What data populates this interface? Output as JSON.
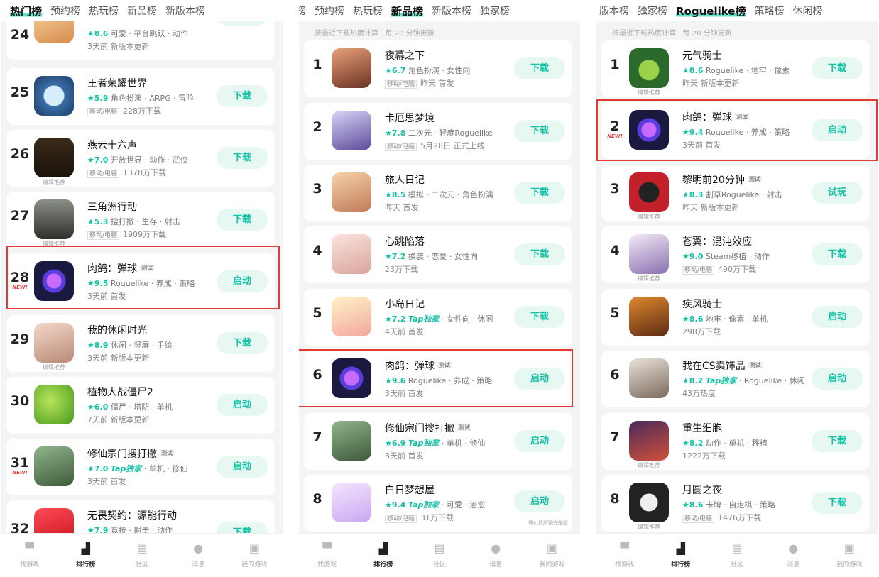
{
  "panels": [
    {
      "tabs": [
        "热门榜",
        "预约榜",
        "热玩榜",
        "新品榜",
        "新版本榜"
      ],
      "note": "",
      "items": [
        {
          "rank": "24",
          "title": "",
          "meta_rating": "★8.6",
          "meta_tags": "可爱 · 平台跳跃 · 动作",
          "sub": "3天前 新版本更新",
          "button": "试玩"
        },
        {
          "rank": "25",
          "title": "王者荣耀世界",
          "meta_rating": "★5.9",
          "meta_tags": "角色扮演 · ARPG · 冒险",
          "platform": "移动/电脑",
          "sub": "228万下载",
          "button": "下载"
        },
        {
          "rank": "26",
          "title": "燕云十六声",
          "meta_rating": "★7.0",
          "meta_tags": "开放世界 · 动作 · 武侠",
          "platform": "移动/电脑",
          "sub": "1378万下载",
          "button": "下载",
          "editor": "编辑推荐"
        },
        {
          "rank": "27",
          "title": "三角洲行动",
          "meta_rating": "★5.3",
          "meta_tags": "搜打撤 · 生存 · 射击",
          "platform": "移动/电脑",
          "sub": "1909万下载",
          "button": "下载",
          "editor": "编辑推荐"
        },
        {
          "rank": "28",
          "new": "NEW!",
          "title": "肉鸽：弹球",
          "test": "测试",
          "meta_rating": "★9.5",
          "meta_tags": "Roguelike · 养成 · 策略",
          "sub": "3天前 首发",
          "button": "启动"
        },
        {
          "rank": "29",
          "title": "我的休闲时光",
          "meta_rating": "★8.9",
          "meta_tags": "休闲 · 竖屏 · 手绘",
          "sub": "3天前 新版本更新",
          "button": "下载",
          "editor": "编辑推荐"
        },
        {
          "rank": "30",
          "title": "植物大战僵尸2",
          "meta_rating": "★6.0",
          "meta_tags": "僵尸 · 塔防 · 单机",
          "sub": "7天前 新版本更新",
          "button": "启动"
        },
        {
          "rank": "31",
          "new": "NEW!",
          "title": "修仙宗门搜打撤",
          "test": "测试",
          "meta_rating": "★7.0",
          "exclusive": "Tap独家",
          "meta_tags": " · 单机 · 修仙",
          "sub": "3天前 首发",
          "button": "启动"
        },
        {
          "rank": "32",
          "title": "无畏契约：源能行动",
          "meta_rating": "★7.9",
          "meta_tags": "竞技 · 射击 · 动作",
          "sub": "",
          "button": "下载"
        }
      ]
    },
    {
      "tabs": [
        "约榜",
        "预约榜",
        "热玩榜",
        "新品榜",
        "新版本榜",
        "独家榜"
      ],
      "note": "按最近下载热度计算 · 每 20 分钟更新",
      "items": [
        {
          "rank": "1",
          "title": "夜幕之下",
          "meta_rating": "★6.7",
          "meta_tags": "角色扮演 · 女性向",
          "platform": "移动/电脑",
          "sub": "昨天 首发",
          "button": "下载"
        },
        {
          "rank": "2",
          "title": "卡厄思梦境",
          "meta_rating": "★7.8",
          "meta_tags": "二次元 · 轻度Roguelike",
          "platform": "移动/电脑",
          "sub": "5月28日 正式上线",
          "button": "下载"
        },
        {
          "rank": "3",
          "title": "旅人日记",
          "meta_rating": "★8.5",
          "meta_tags": "模拟 · 二次元 · 角色扮演",
          "sub": "昨天 首发",
          "button": "下载"
        },
        {
          "rank": "4",
          "title": "心跳陷落",
          "meta_rating": "★7.2",
          "meta_tags": "换装 · 恋爱 · 女性向",
          "sub": "23万下载",
          "button": "下载"
        },
        {
          "rank": "5",
          "title": "小岛日记",
          "meta_rating": "★7.2",
          "exclusive": "Tap独家",
          "meta_tags": " · 女性向 · 休闲",
          "sub": "4天前 首发",
          "button": "下载"
        },
        {
          "rank": "6",
          "title": "肉鸽：弹球",
          "test": "测试",
          "meta_rating": "★9.6",
          "meta_tags": "Roguelike · 养成 · 策略",
          "sub": "3天前 首发",
          "button": "启动"
        },
        {
          "rank": "7",
          "title": "修仙宗门搜打撤",
          "test": "测试",
          "meta_rating": "★6.9",
          "exclusive": "Tap独家",
          "meta_tags": " · 单机 · 修仙",
          "sub": "3天前 首发",
          "button": "启动"
        },
        {
          "rank": "8",
          "title": "白日梦想屋",
          "meta_rating": "★9.4",
          "exclusive": "Tap独家",
          "meta_tags": " · 可爱 · 治愈",
          "platform": "移动/电脑",
          "sub": "31万下载",
          "button": "启动",
          "button_note": "需付费解锁完整版"
        }
      ]
    },
    {
      "tabs": [
        "版本榜",
        "独家榜",
        "Roguelike榜",
        "策略榜",
        "休闲榜"
      ],
      "note": "按最近下载热度计算 · 每 20 分钟更新",
      "items": [
        {
          "rank": "1",
          "title": "元气骑士",
          "meta_rating": "★8.6",
          "meta_tags": "Roguelike · 地牢 · 像素",
          "sub": "昨天 新版本更新",
          "button": "下载",
          "editor": "编辑推荐"
        },
        {
          "rank": "2",
          "new": "NEW!",
          "title": "肉鸽：弹球",
          "test": "测试",
          "meta_rating": "★9.4",
          "meta_tags": "Roguelike · 养成 · 策略",
          "sub": "3天前 首发",
          "button": "启动"
        },
        {
          "rank": "3",
          "title": "黎明前20分钟",
          "test": "测试",
          "meta_rating": "★8.3",
          "meta_tags": "割草Roguelike · 射击",
          "sub": "昨天 新版本更新",
          "button": "试玩",
          "editor": "编辑推荐"
        },
        {
          "rank": "4",
          "title": "苍翼：混沌效应",
          "meta_rating": "★9.0",
          "meta_tags": "Steam移植 · 动作",
          "platform": "移动/电脑",
          "sub": "490万下载",
          "button": "下载",
          "editor": "编辑推荐"
        },
        {
          "rank": "5",
          "title": "疾风骑士",
          "meta_rating": "★8.6",
          "meta_tags": "地牢 · 像素 · 单机",
          "sub": "298万下载",
          "button": "启动"
        },
        {
          "rank": "6",
          "title": "我在CS卖饰品",
          "test": "测试",
          "meta_rating": "★8.2",
          "exclusive": "Tap独家",
          "meta_tags": " · Roguelike · 休闲",
          "sub": "43万热度",
          "button": "启动"
        },
        {
          "rank": "7",
          "title": "重生细胞",
          "meta_rating": "★8.2",
          "meta_tags": "动作 · 单机 · 移植",
          "sub": "1222万下载",
          "button": "下载",
          "editor": "编辑推荐"
        },
        {
          "rank": "8",
          "title": "月圆之夜",
          "meta_rating": "★8.6",
          "meta_tags": "卡牌 · 自走棋 · 策略",
          "platform": "移动/电脑",
          "sub": "1476万下载",
          "button": "下载",
          "editor": "编辑推荐"
        }
      ]
    }
  ],
  "bottom_nav": [
    {
      "label": "找游戏",
      "icon": "controller-icon"
    },
    {
      "label": "排行榜",
      "icon": "ranking-icon"
    },
    {
      "label": "社区",
      "icon": "community-icon"
    },
    {
      "label": "消息",
      "icon": "message-icon"
    },
    {
      "label": "我的游戏",
      "icon": "my-games-icon"
    }
  ],
  "colors": {
    "accent": "#13c2a6",
    "highlight": "#e53935",
    "button_bg": "#e7f8f3"
  }
}
